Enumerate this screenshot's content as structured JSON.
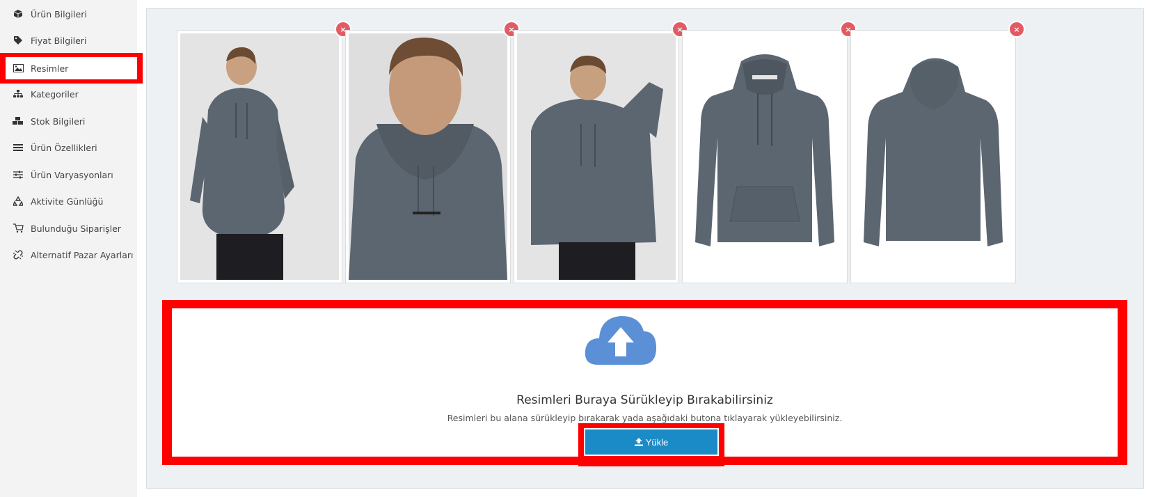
{
  "sidebar": {
    "items": [
      {
        "label": "Ürün Bilgileri",
        "icon": "box-icon"
      },
      {
        "label": "Fiyat Bilgileri",
        "icon": "tag-icon"
      },
      {
        "label": "Resimler",
        "icon": "image-icon"
      },
      {
        "label": "Kategoriler",
        "icon": "sitemap-icon"
      },
      {
        "label": "Stok Bilgileri",
        "icon": "boxes-icon"
      },
      {
        "label": "Ürün Özellikleri",
        "icon": "list-icon"
      },
      {
        "label": "Ürün Varyasyonları",
        "icon": "sliders-icon"
      },
      {
        "label": "Aktivite Günlüğü",
        "icon": "recycle-icon"
      },
      {
        "label": "Bulunduğu Siparişler",
        "icon": "cart-icon"
      },
      {
        "label": "Alternatif Pazar Ayarları",
        "icon": "unlink-icon"
      }
    ],
    "active_index": 2
  },
  "images": [
    {
      "kind": "model-front",
      "delete_label": "×"
    },
    {
      "kind": "model-closeup",
      "delete_label": "×"
    },
    {
      "kind": "model-pose",
      "delete_label": "×"
    },
    {
      "kind": "hoodie-front",
      "delete_label": "×"
    },
    {
      "kind": "hoodie-back",
      "delete_label": "×"
    }
  ],
  "dropzone": {
    "icon": "cloud-upload-icon",
    "title": "Resimleri Buraya Sürükleyip Bırakabilirsiniz",
    "subtitle": "Resimleri bu alana sürükleyip bırakarak yada aşağıdaki butona tıklayarak yükleyebilirsiniz.",
    "button_label": "Yükle"
  },
  "colors": {
    "highlight": "#ff0000",
    "button": "#1a8bc7",
    "cloud": "#5b8fd6",
    "delete": "#e25b64",
    "hoodie": "#5c6670"
  }
}
